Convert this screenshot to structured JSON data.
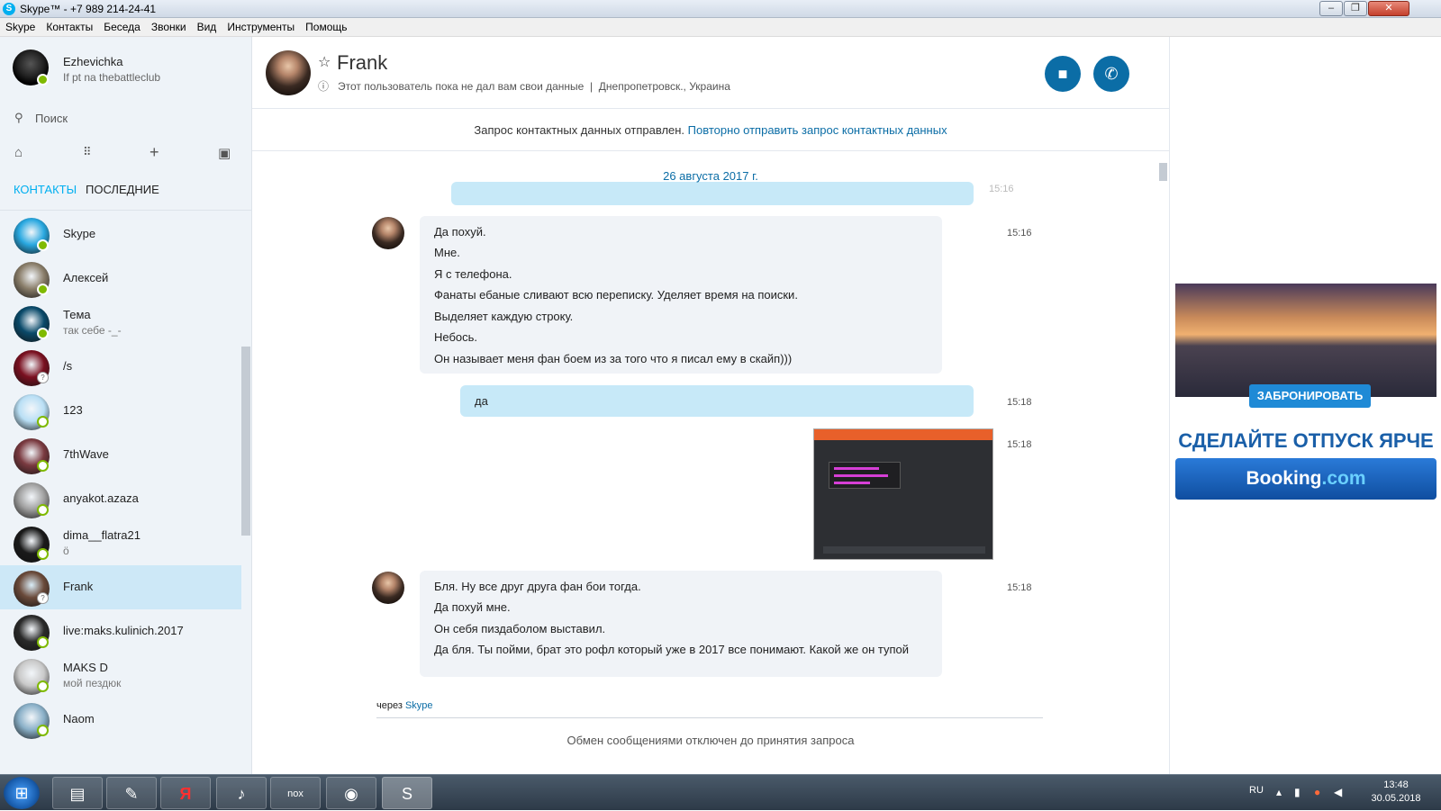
{
  "window": {
    "title": "Skype™ - +7 989 214-24-41"
  },
  "menu": [
    "Skype",
    "Контакты",
    "Беседа",
    "Звонки",
    "Вид",
    "Инструменты",
    "Помощь"
  ],
  "profile": {
    "name": "Ezhevichka",
    "mood": "If pt na thebattleclub"
  },
  "search": {
    "placeholder": "Поиск"
  },
  "tabs": {
    "contacts": "КОНТАКТЫ",
    "recent": "ПОСЛЕДНИЕ"
  },
  "contacts": [
    {
      "name": "Skype",
      "mood": "",
      "status": "online",
      "avatar_color": "#29a8e0"
    },
    {
      "name": "Алексей",
      "mood": "",
      "status": "online",
      "avatar_color": "#8a7e6a"
    },
    {
      "name": "Тема",
      "mood": "так себе -_-",
      "status": "online",
      "avatar_color": "#0a4a6a"
    },
    {
      "name": "/s",
      "mood": "",
      "status": "unknown",
      "avatar_color": "#7a1020"
    },
    {
      "name": "123",
      "mood": "",
      "status": "offline",
      "avatar_color": "#b9dff5"
    },
    {
      "name": "7thWave",
      "mood": "",
      "status": "offline",
      "avatar_color": "#7a3a40"
    },
    {
      "name": "anyakot.azaza",
      "mood": "",
      "status": "offline",
      "avatar_color": "#a0a0a0"
    },
    {
      "name": "dima__flatra21",
      "mood": "ö",
      "status": "offline",
      "avatar_color": "#1a1a1a"
    },
    {
      "name": "Frank",
      "mood": "",
      "status": "unknown",
      "avatar_color": "#6a4a3a",
      "selected": true
    },
    {
      "name": "live:maks.kulinich.2017",
      "mood": "",
      "status": "offline",
      "avatar_color": "#2a2a2a"
    },
    {
      "name": "MAKS D",
      "mood": "мой пездюк",
      "status": "offline",
      "avatar_color": "#c9c9c9"
    },
    {
      "name": "Naom",
      "mood": "",
      "status": "offline",
      "avatar_color": "#8ab0c8"
    }
  ],
  "chat": {
    "name": "Frank",
    "info": "Этот пользователь пока не дал вам свои данные  |  Днепропетровск., Украина",
    "notice_text": "Запрос контактных данных отправлен.",
    "notice_link": "Повторно отправить запрос контактных данных",
    "date": "26 августа 2017 г.",
    "partial_time": "15:16",
    "messages": [
      {
        "dir": "in",
        "time": "15:16",
        "lines": [
          "Да похуй.",
          "Мне.",
          "Я с телефона.",
          "Фанаты ебаные сливают всю переписку. Уделяет время на поиски.",
          "Выделяет каждую строку.",
          "Небось.",
          "Он называет меня фан боем из за того что я писал ему в скайп)))"
        ]
      },
      {
        "dir": "out",
        "time": "15:18",
        "lines": [
          "да"
        ]
      },
      {
        "dir": "out",
        "time": "15:18",
        "image": "screenshot"
      },
      {
        "dir": "in",
        "time": "15:18",
        "lines": [
          "Бля. Ну все друг друга фан бои тогда.",
          "Да похуй мне.",
          "Он себя пиздаболом выставил.",
          "Да бля. Ты пойми, брат это рофл который уже в 2017 все понимают. Какой же он тупой"
        ]
      }
    ],
    "via_prefix": "через",
    "via_link": "Skype",
    "blocked": "Обмен сообщениями отключен до принятия запроса"
  },
  "ad": {
    "button": "ЗАБРОНИРОВАТЬ",
    "slogan": "СДЕЛАЙТЕ ОТПУСК ЯРЧЕ",
    "brand_a": "Booking",
    ".com": ".com",
    "brand_b": ".com"
  },
  "taskbar": {
    "lang": "RU",
    "time": "13:48",
    "date": "30.05.2018"
  },
  "colors": {
    "accent": "#00aff0",
    "call_button": "#0b6da6",
    "selected_row": "#cde8f7",
    "outgoing_bubble": "#c7e9f8",
    "incoming_bubble": "#f0f3f7"
  }
}
